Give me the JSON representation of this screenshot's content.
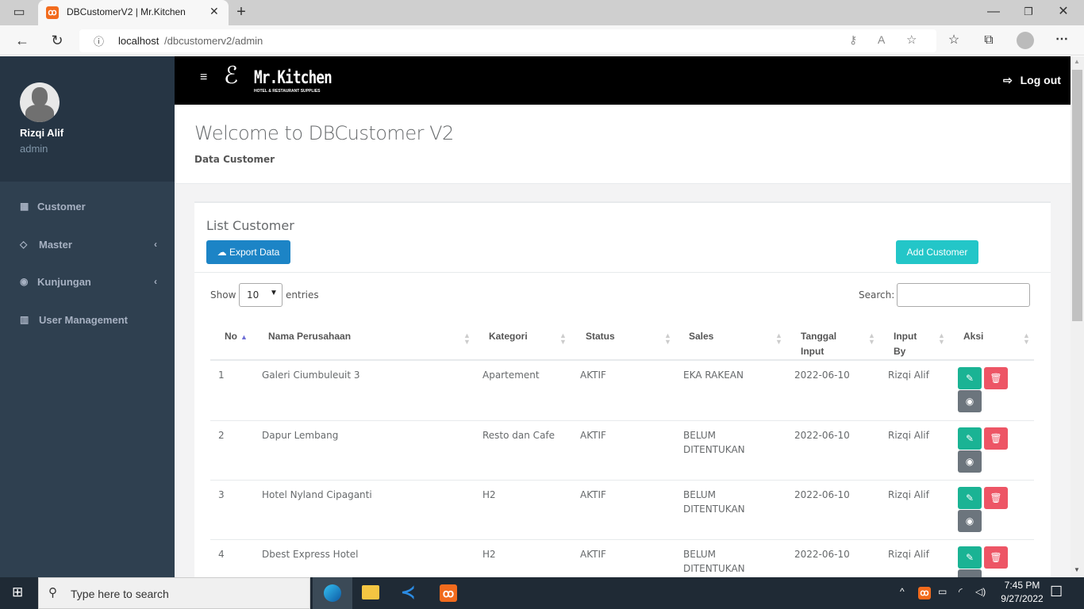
{
  "browser": {
    "tab_title": "DBCustomerV2 | Mr.Kitchen",
    "url_host": "localhost",
    "url_path": "/dbcustomerv2/admin"
  },
  "sidebar": {
    "user_name": "Rizqi Alif",
    "user_role": "admin",
    "items": [
      {
        "label": "Customer",
        "icon": "th-large-icon",
        "has_children": false
      },
      {
        "label": "Master",
        "icon": "diamond-icon",
        "has_children": true
      },
      {
        "label": "Kunjungan",
        "icon": "eye-icon",
        "has_children": true
      },
      {
        "label": "User Management",
        "icon": "bar-chart-icon",
        "has_children": false
      }
    ]
  },
  "header": {
    "logo_text": "Mr.Kitchen",
    "logo_subtext": "HOTEL & RESTAURANT SUPPLIES",
    "logout_label": "Log out"
  },
  "page": {
    "title": "Welcome to DBCustomer V2",
    "breadcrumb": "Data Customer",
    "box_title": "List Customer",
    "export_label": "Export Data",
    "add_label": "Add Customer",
    "show_label": "Show",
    "entries_value": "10",
    "entries_label": "entries",
    "search_label": "Search:",
    "search_value": ""
  },
  "table": {
    "columns": [
      "No",
      "Nama Perusahaan",
      "Kategori",
      "Status",
      "Sales",
      "Tanggal Input",
      "Input By",
      "Aksi"
    ],
    "rows": [
      {
        "no": "1",
        "nama": "Galeri Ciumbuleuit 3",
        "kategori": "Apartement",
        "status": "AKTIF",
        "sales": "EKA RAKEAN",
        "tanggal": "2022-06-10",
        "input_by": "Rizqi Alif"
      },
      {
        "no": "2",
        "nama": "Dapur Lembang",
        "kategori": "Resto dan Cafe",
        "status": "AKTIF",
        "sales": "BELUM DITENTUKAN",
        "tanggal": "2022-06-10",
        "input_by": "Rizqi Alif"
      },
      {
        "no": "3",
        "nama": "Hotel Nyland Cipaganti",
        "kategori": "H2",
        "status": "AKTIF",
        "sales": "BELUM DITENTUKAN",
        "tanggal": "2022-06-10",
        "input_by": "Rizqi Alif"
      },
      {
        "no": "4",
        "nama": "Dbest Express Hotel",
        "kategori": "H2",
        "status": "AKTIF",
        "sales": "BELUM DITENTUKAN",
        "tanggal": "2022-06-10",
        "input_by": "Rizqi Alif"
      }
    ]
  },
  "colors": {
    "sidebar_bg": "#2f4050",
    "export_btn": "#1c84c6",
    "add_btn": "#23c6c8",
    "edit_btn": "#1ab394",
    "delete_btn": "#ed5565",
    "view_btn": "#6c757d"
  },
  "taskbar": {
    "search_placeholder": "Type here to search",
    "time": "7:45 PM",
    "date": "9/27/2022"
  }
}
